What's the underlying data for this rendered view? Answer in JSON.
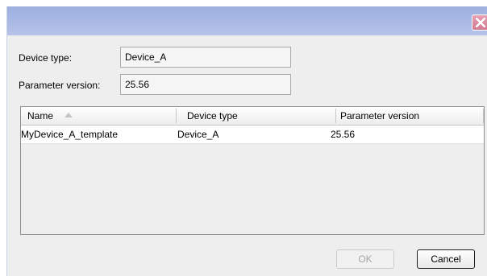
{
  "form": {
    "device_type_label": "Device type:",
    "device_type_value": "Device_A",
    "parameter_version_label": "Parameter version:",
    "parameter_version_value": "25.56"
  },
  "table": {
    "headers": [
      "Name",
      "Device type",
      "Parameter version"
    ],
    "sort_indicator": "sort-ascending-icon",
    "rows": [
      [
        "MyDevice_A_template",
        "Device_A",
        "25.56"
      ]
    ]
  },
  "buttons": {
    "ok": "OK",
    "cancel": "Cancel"
  },
  "colors": {
    "titlebar": "#a8b8e4",
    "close_button": "#d37b93",
    "dialog_background": "#eeeeee"
  }
}
